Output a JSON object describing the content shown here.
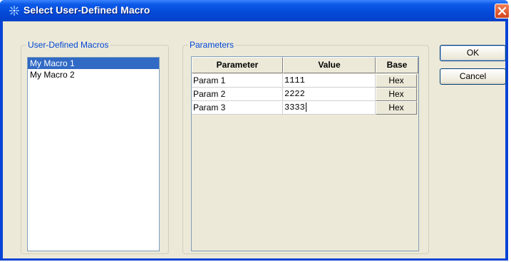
{
  "window": {
    "title": "Select User-Defined Macro",
    "title_icon": "agilent-spark-icon"
  },
  "macros_group": {
    "label": "User-Defined Macros",
    "items": [
      {
        "label": "My Macro 1",
        "selected": true
      },
      {
        "label": "My Macro 2",
        "selected": false
      }
    ]
  },
  "params_group": {
    "label": "Parameters",
    "headers": {
      "parameter": "Parameter",
      "value": "Value",
      "base": "Base"
    },
    "rows": [
      {
        "name": "Param 1",
        "value": "1111",
        "base": "Hex"
      },
      {
        "name": "Param 2",
        "value": "2222",
        "base": "Hex"
      },
      {
        "name": "Param 3",
        "value": "3333",
        "base": "Hex"
      }
    ]
  },
  "buttons": {
    "ok": "OK",
    "cancel": "Cancel"
  },
  "colors": {
    "title_bar": "#0449d8",
    "dialog_face": "#ece9d8",
    "selection": "#316ac5",
    "group_label": "#0046d5"
  }
}
